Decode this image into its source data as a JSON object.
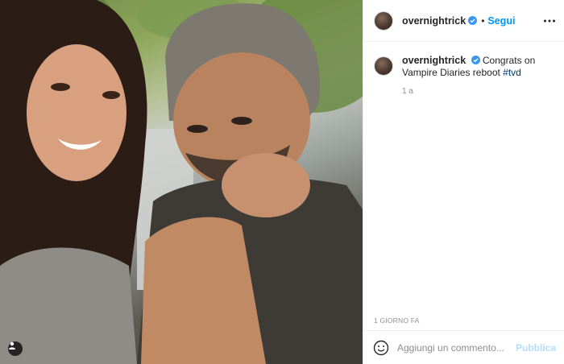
{
  "post": {
    "image_alt": "Selfie of a smiling woman and a bearded man resting his chin on his hand, greenery in the background",
    "icons": {
      "user_tag": "user-tag-icon"
    }
  },
  "header": {
    "username": "overnightrick",
    "verified_icon": "verified-badge-icon",
    "dot": "•",
    "follow_label": "Segui",
    "more_icon": "more-options-icon"
  },
  "caption": {
    "username": "overnightrick",
    "text": "Congrats on Vampire Diaries reboot",
    "hashtag": "#tvd",
    "time": "1 a"
  },
  "footer": {
    "date": "1 GIORNO FA",
    "emoji_icon": "emoji-icon",
    "comment_placeholder": "Aggiungi un commento...",
    "publish_label": "Pubblica"
  },
  "colors": {
    "link_blue": "#0095f6",
    "publish_disabled": "#b2dffc",
    "hashtag": "#00376b",
    "muted": "#8e8e8e",
    "border": "#efefef"
  }
}
